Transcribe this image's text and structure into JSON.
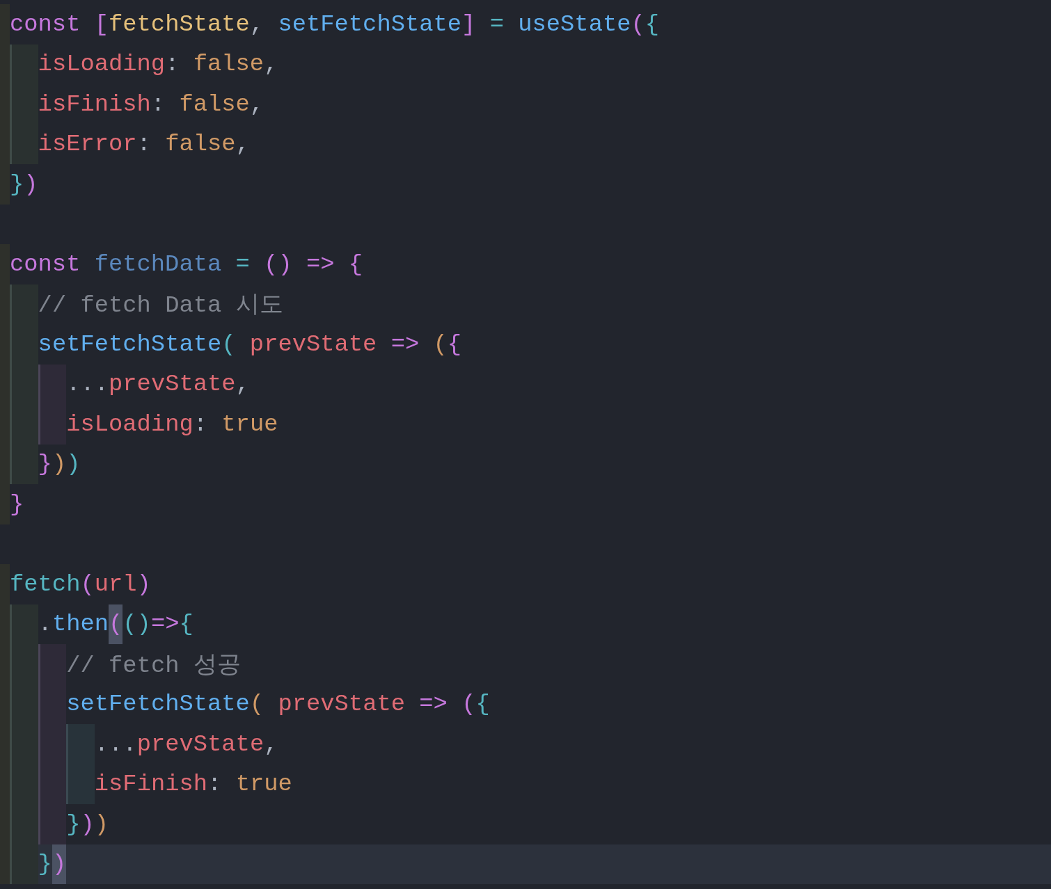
{
  "editor": {
    "lines": [
      {
        "kind": "code",
        "current": false,
        "tokens": [
          {
            "kind": "keyword",
            "text": "const ",
            "matched": false
          },
          {
            "kind": "bracket-a",
            "text": "[",
            "matched": false
          },
          {
            "kind": "variable",
            "text": "fetchState",
            "matched": false
          },
          {
            "kind": "punctuation",
            "text": ", ",
            "matched": false
          },
          {
            "kind": "function",
            "text": "setFetchState",
            "matched": false
          },
          {
            "kind": "bracket-a",
            "text": "]",
            "matched": false
          },
          {
            "kind": "operator",
            "text": " = ",
            "matched": false
          },
          {
            "kind": "function",
            "text": "useState",
            "matched": false
          },
          {
            "kind": "bracket-a",
            "text": "(",
            "matched": false
          },
          {
            "kind": "bracket-b",
            "text": "{",
            "matched": false
          }
        ]
      },
      {
        "kind": "code",
        "current": false,
        "tokens": [
          {
            "kind": "property",
            "text": "  isLoading",
            "matched": false
          },
          {
            "kind": "punctuation",
            "text": ": ",
            "matched": false
          },
          {
            "kind": "literal",
            "text": "false",
            "matched": false
          },
          {
            "kind": "punctuation",
            "text": ",",
            "matched": false
          }
        ]
      },
      {
        "kind": "code",
        "current": false,
        "tokens": [
          {
            "kind": "property",
            "text": "  isFinish",
            "matched": false
          },
          {
            "kind": "punctuation",
            "text": ": ",
            "matched": false
          },
          {
            "kind": "literal",
            "text": "false",
            "matched": false
          },
          {
            "kind": "punctuation",
            "text": ",",
            "matched": false
          }
        ]
      },
      {
        "kind": "code",
        "current": false,
        "tokens": [
          {
            "kind": "property",
            "text": "  isError",
            "matched": false
          },
          {
            "kind": "punctuation",
            "text": ": ",
            "matched": false
          },
          {
            "kind": "literal",
            "text": "false",
            "matched": false
          },
          {
            "kind": "punctuation",
            "text": ",",
            "matched": false
          }
        ]
      },
      {
        "kind": "code",
        "current": false,
        "tokens": [
          {
            "kind": "bracket-b",
            "text": "}",
            "matched": false
          },
          {
            "kind": "bracket-a",
            "text": ")",
            "matched": false
          }
        ]
      },
      {
        "kind": "blank",
        "current": false
      },
      {
        "kind": "code",
        "current": false,
        "tokens": [
          {
            "kind": "keyword",
            "text": "const ",
            "matched": false
          },
          {
            "kind": "function-dim",
            "text": "fetchData",
            "matched": false
          },
          {
            "kind": "operator",
            "text": " = ",
            "matched": false
          },
          {
            "kind": "bracket-a",
            "text": "()",
            "matched": false
          },
          {
            "kind": "keyword",
            "text": " => ",
            "matched": false
          },
          {
            "kind": "bracket-a",
            "text": "{",
            "matched": false
          }
        ]
      },
      {
        "kind": "code",
        "current": false,
        "tokens": [
          {
            "kind": "comment",
            "text": "  // fetch Data 시도",
            "matched": false
          }
        ]
      },
      {
        "kind": "code",
        "current": false,
        "tokens": [
          {
            "kind": "function",
            "text": "  setFetchState",
            "matched": false
          },
          {
            "kind": "bracket-b",
            "text": "(",
            "matched": false
          },
          {
            "kind": "property",
            "text": " prevState",
            "matched": false
          },
          {
            "kind": "keyword",
            "text": " => ",
            "matched": false
          },
          {
            "kind": "bracket-c",
            "text": "(",
            "matched": false
          },
          {
            "kind": "bracket-a",
            "text": "{",
            "matched": false
          }
        ]
      },
      {
        "kind": "code",
        "current": false,
        "tokens": [
          {
            "kind": "punctuation",
            "text": "    ...",
            "matched": false
          },
          {
            "kind": "property",
            "text": "prevState",
            "matched": false
          },
          {
            "kind": "punctuation",
            "text": ",",
            "matched": false
          }
        ]
      },
      {
        "kind": "code",
        "current": false,
        "tokens": [
          {
            "kind": "property",
            "text": "    isLoading",
            "matched": false
          },
          {
            "kind": "punctuation",
            "text": ": ",
            "matched": false
          },
          {
            "kind": "literal",
            "text": "true",
            "matched": false
          }
        ]
      },
      {
        "kind": "code",
        "current": false,
        "tokens": [
          {
            "kind": "bracket-a",
            "text": "  }",
            "matched": false
          },
          {
            "kind": "bracket-c",
            "text": ")",
            "matched": false
          },
          {
            "kind": "bracket-b",
            "text": ")",
            "matched": false
          }
        ]
      },
      {
        "kind": "code",
        "current": false,
        "tokens": [
          {
            "kind": "bracket-a",
            "text": "}",
            "matched": false
          }
        ]
      },
      {
        "kind": "blank",
        "current": false
      },
      {
        "kind": "code",
        "current": false,
        "tokens": [
          {
            "kind": "builtin",
            "text": "fetch",
            "matched": false
          },
          {
            "kind": "bracket-a",
            "text": "(",
            "matched": false
          },
          {
            "kind": "property",
            "text": "url",
            "matched": false
          },
          {
            "kind": "bracket-a",
            "text": ")",
            "matched": false
          }
        ]
      },
      {
        "kind": "code",
        "current": false,
        "tokens": [
          {
            "kind": "punctuation",
            "text": "  .",
            "matched": false
          },
          {
            "kind": "function",
            "text": "then",
            "matched": false
          },
          {
            "kind": "bracket-a",
            "text": "(",
            "matched": true
          },
          {
            "kind": "bracket-b",
            "text": "()",
            "matched": false
          },
          {
            "kind": "keyword",
            "text": "=>",
            "matched": false
          },
          {
            "kind": "bracket-b",
            "text": "{",
            "matched": false
          }
        ]
      },
      {
        "kind": "code",
        "current": false,
        "tokens": [
          {
            "kind": "comment",
            "text": "    // fetch 성공",
            "matched": false
          }
        ]
      },
      {
        "kind": "code",
        "current": false,
        "tokens": [
          {
            "kind": "function",
            "text": "    setFetchState",
            "matched": false
          },
          {
            "kind": "bracket-c",
            "text": "(",
            "matched": false
          },
          {
            "kind": "property",
            "text": " prevState",
            "matched": false
          },
          {
            "kind": "keyword",
            "text": " => ",
            "matched": false
          },
          {
            "kind": "bracket-a",
            "text": "(",
            "matched": false
          },
          {
            "kind": "bracket-b",
            "text": "{",
            "matched": false
          }
        ]
      },
      {
        "kind": "code",
        "current": false,
        "tokens": [
          {
            "kind": "punctuation",
            "text": "      ...",
            "matched": false
          },
          {
            "kind": "property",
            "text": "prevState",
            "matched": false
          },
          {
            "kind": "punctuation",
            "text": ",",
            "matched": false
          }
        ]
      },
      {
        "kind": "code",
        "current": false,
        "tokens": [
          {
            "kind": "property",
            "text": "      isFinish",
            "matched": false
          },
          {
            "kind": "punctuation",
            "text": ": ",
            "matched": false
          },
          {
            "kind": "literal",
            "text": "true",
            "matched": false
          }
        ]
      },
      {
        "kind": "code",
        "current": false,
        "tokens": [
          {
            "kind": "bracket-b",
            "text": "    }",
            "matched": false
          },
          {
            "kind": "bracket-a",
            "text": ")",
            "matched": false
          },
          {
            "kind": "bracket-c",
            "text": ")",
            "matched": false
          }
        ]
      },
      {
        "kind": "code",
        "current": true,
        "tokens": [
          {
            "kind": "bracket-b",
            "text": "  }",
            "matched": false
          },
          {
            "kind": "bracket-a",
            "text": ")",
            "matched": true
          }
        ]
      }
    ]
  }
}
